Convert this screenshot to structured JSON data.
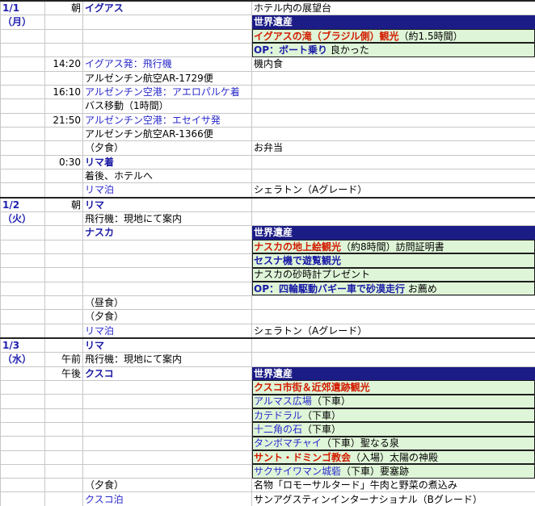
{
  "rows": [
    {
      "sep": true,
      "c0": "1/1",
      "c1": "朝",
      "c2": [
        {
          "t": "イグアス",
          "s": "blue-bold"
        }
      ],
      "c3": [
        {
          "t": "ホテル内の展望台",
          "s": "plain"
        }
      ],
      "c3bg": ""
    },
    {
      "c0": "（月）",
      "c1": "",
      "c2": [],
      "c3": [
        {
          "t": "世界遺産",
          "s": "plain"
        }
      ],
      "c3bg": "blue"
    },
    {
      "c0": "",
      "c1": "",
      "c2": [],
      "c3": [
        {
          "t": "イグアスの滝（ブラジル側）観光",
          "s": "red-bold"
        },
        {
          "t": "（約1.5時間）",
          "s": "plain"
        }
      ],
      "c3bg": "green"
    },
    {
      "c0": "",
      "c1": "",
      "c2": [],
      "c3": [
        {
          "t": "OP：ボート乗り",
          "s": "blue-bold"
        },
        {
          "t": " 良かった",
          "s": "plain"
        }
      ],
      "c3bg": "green"
    },
    {
      "c0": "",
      "c1": "14:20",
      "c2": [
        {
          "t": "イグアス発：飛行機",
          "s": "blue"
        }
      ],
      "c3": [
        {
          "t": "機内食",
          "s": "plain"
        }
      ],
      "c3bg": ""
    },
    {
      "c0": "",
      "c1": "",
      "c2": [
        {
          "t": "アルゼンチン航空AR-1729便",
          "s": "plain"
        }
      ],
      "c3": [],
      "c3bg": ""
    },
    {
      "c0": "",
      "c1": "16:10",
      "c2": [
        {
          "t": "アルゼンチン空港：アエロパルケ着",
          "s": "blue"
        }
      ],
      "c3": [],
      "c3bg": ""
    },
    {
      "c0": "",
      "c1": "",
      "c2": [
        {
          "t": "バス移動（1時間）",
          "s": "plain"
        }
      ],
      "c3": [],
      "c3bg": ""
    },
    {
      "c0": "",
      "c1": "21:50",
      "c2": [
        {
          "t": "アルゼンチン空港：エセイサ発",
          "s": "blue"
        }
      ],
      "c3": [],
      "c3bg": ""
    },
    {
      "c0": "",
      "c1": "",
      "c2": [
        {
          "t": "アルゼンチン航空AR-1366便",
          "s": "plain"
        }
      ],
      "c3": [],
      "c3bg": ""
    },
    {
      "c0": "",
      "c1": "",
      "c2": [
        {
          "t": "（夕食）",
          "s": "plain"
        }
      ],
      "c3": [
        {
          "t": "お弁当",
          "s": "plain"
        }
      ],
      "c3bg": ""
    },
    {
      "c0": "",
      "c1": "0:30",
      "c2": [
        {
          "t": "リマ着",
          "s": "blue-bold"
        }
      ],
      "c3": [],
      "c3bg": ""
    },
    {
      "c0": "",
      "c1": "",
      "c2": [
        {
          "t": "着後、ホテルへ",
          "s": "plain"
        }
      ],
      "c3": [],
      "c3bg": ""
    },
    {
      "c0": "",
      "c1": "",
      "c2": [
        {
          "t": "リマ泊",
          "s": "blue"
        }
      ],
      "c3": [
        {
          "t": "シェラトン（Aグレード）",
          "s": "plain"
        }
      ],
      "c3bg": ""
    },
    {
      "sep": true,
      "c0": "1/2",
      "c1": "朝",
      "c2": [
        {
          "t": "リマ",
          "s": "blue-bold"
        }
      ],
      "c3": [],
      "c3bg": ""
    },
    {
      "c0": "（火）",
      "c1": "",
      "c2": [
        {
          "t": "飛行機：現地にて案内",
          "s": "plain"
        }
      ],
      "c3": [],
      "c3bg": ""
    },
    {
      "c0": "",
      "c1": "",
      "c2": [
        {
          "t": "ナスカ",
          "s": "blue-bold"
        }
      ],
      "c3": [
        {
          "t": "世界遺産",
          "s": "plain"
        }
      ],
      "c3bg": "blue"
    },
    {
      "c0": "",
      "c1": "",
      "c2": [],
      "c3": [
        {
          "t": "ナスカの地上絵観光",
          "s": "red-bold"
        },
        {
          "t": "（約8時間）訪問証明書",
          "s": "plain"
        }
      ],
      "c3bg": "green"
    },
    {
      "c0": "",
      "c1": "",
      "c2": [],
      "c3": [
        {
          "t": "セスナ機で遊覧観光",
          "s": "blue-bold"
        }
      ],
      "c3bg": "green"
    },
    {
      "c0": "",
      "c1": "",
      "c2": [],
      "c3": [
        {
          "t": "ナスカの砂時計プレゼント",
          "s": "plain"
        }
      ],
      "c3bg": "green"
    },
    {
      "c0": "",
      "c1": "",
      "c2": [],
      "c3": [
        {
          "t": "OP：四輪駆動バギー車で砂漠走行",
          "s": "blue-bold"
        },
        {
          "t": " お薦め",
          "s": "plain"
        }
      ],
      "c3bg": "green"
    },
    {
      "c0": "",
      "c1": "",
      "c2": [
        {
          "t": "（昼食）",
          "s": "plain"
        }
      ],
      "c3": [],
      "c3bg": ""
    },
    {
      "c0": "",
      "c1": "",
      "c2": [
        {
          "t": "（夕食）",
          "s": "plain"
        }
      ],
      "c3": [],
      "c3bg": ""
    },
    {
      "c0": "",
      "c1": "",
      "c2": [
        {
          "t": "リマ泊",
          "s": "blue"
        }
      ],
      "c3": [
        {
          "t": "シェラトン（Aグレード）",
          "s": "plain"
        }
      ],
      "c3bg": ""
    },
    {
      "sep": true,
      "c0": "1/3",
      "c1": "",
      "c2": [
        {
          "t": "リマ",
          "s": "blue-bold"
        }
      ],
      "c3": [],
      "c3bg": ""
    },
    {
      "c0": "（水）",
      "c1": "午前",
      "c2": [
        {
          "t": "飛行機：現地にて案内",
          "s": "plain"
        }
      ],
      "c3": [],
      "c3bg": ""
    },
    {
      "c0": "",
      "c1": "午後",
      "c2": [
        {
          "t": "クスコ",
          "s": "blue-bold"
        }
      ],
      "c3": [
        {
          "t": "世界遺産",
          "s": "plain"
        }
      ],
      "c3bg": "blue"
    },
    {
      "c0": "",
      "c1": "",
      "c2": [],
      "c3": [
        {
          "t": "クスコ市街＆近郊遺跡観光",
          "s": "red-bold"
        }
      ],
      "c3bg": "green"
    },
    {
      "c0": "",
      "c1": "",
      "c2": [],
      "c3": [
        {
          "t": "アルマス広場",
          "s": "blue"
        },
        {
          "t": "（下車）",
          "s": "plain"
        }
      ],
      "c3bg": "green"
    },
    {
      "c0": "",
      "c1": "",
      "c2": [],
      "c3": [
        {
          "t": "カテドラル",
          "s": "blue"
        },
        {
          "t": "（下車）",
          "s": "plain"
        }
      ],
      "c3bg": "green"
    },
    {
      "c0": "",
      "c1": "",
      "c2": [],
      "c3": [
        {
          "t": "十二角の石",
          "s": "blue"
        },
        {
          "t": "（下車）",
          "s": "plain"
        }
      ],
      "c3bg": "green"
    },
    {
      "c0": "",
      "c1": "",
      "c2": [],
      "c3": [
        {
          "t": "タンボマチャイ",
          "s": "blue"
        },
        {
          "t": "（下車）聖なる泉",
          "s": "plain"
        }
      ],
      "c3bg": "green"
    },
    {
      "c0": "",
      "c1": "",
      "c2": [],
      "c3": [
        {
          "t": "サント・ドミンゴ教会",
          "s": "red-bold"
        },
        {
          "t": "（入場）太陽の神殿",
          "s": "plain"
        }
      ],
      "c3bg": "green"
    },
    {
      "c0": "",
      "c1": "",
      "c2": [],
      "c3": [
        {
          "t": "サクサイワマン城砦",
          "s": "blue"
        },
        {
          "t": "（下車）要塞跡",
          "s": "plain"
        }
      ],
      "c3bg": "green"
    },
    {
      "c0": "",
      "c1": "",
      "c2": [
        {
          "t": "（夕食）",
          "s": "plain"
        }
      ],
      "c3": [
        {
          "t": "名物「ロモーサルタード」牛肉と野菜の煮込み",
          "s": "plain"
        }
      ],
      "c3bg": ""
    },
    {
      "c0": "",
      "c1": "",
      "c2": [
        {
          "t": "クスコ泊",
          "s": "blue"
        }
      ],
      "c3": [
        {
          "t": "サンアグスティンインターナショナル（Bグレード）",
          "s": "plain"
        }
      ],
      "c3bg": ""
    }
  ]
}
